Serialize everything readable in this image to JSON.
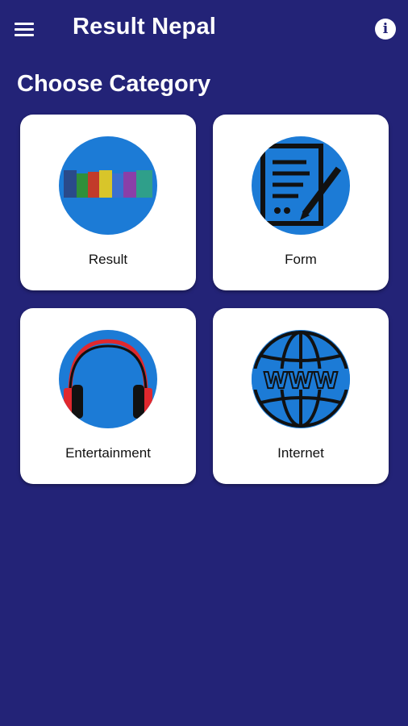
{
  "appbar": {
    "title": "Result Nepal",
    "menu_icon": "hamburger-menu-icon",
    "info_icon": "info-icon"
  },
  "main": {
    "heading": "Choose Category",
    "categories": [
      {
        "label": "Result",
        "icon": "results-logo-icon"
      },
      {
        "label": "Form",
        "icon": "form-document-icon"
      },
      {
        "label": "Entertainment",
        "icon": "headphones-icon"
      },
      {
        "label": "Internet",
        "icon": "www-globe-icon"
      }
    ]
  },
  "colors": {
    "background": "#232377",
    "card": "#ffffff",
    "icon_circle": "#1c7bd6"
  }
}
